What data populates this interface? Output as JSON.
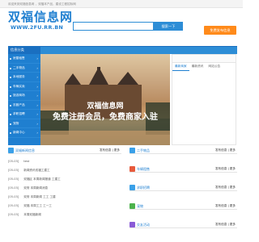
{
  "topbar": {
    "notice": "欢迎来到双福信息网 ，双福本产品，建设工程招标网"
  },
  "logo": {
    "title": "双福信息网",
    "url": "WWW.2FU.RR.BN"
  },
  "search": {
    "tabs": [
      "信息",
      "商家",
      "新闻",
      "找工作"
    ],
    "button_label": "搜索一下",
    "placeholder": ""
  },
  "post_button": "免费发布信息",
  "sidebar": {
    "heading": "信息分类",
    "items": [
      "房屋租售",
      "二手物品",
      "本地服务",
      "车辆买卖",
      "旅游商场",
      "农副产品",
      "求职招聘",
      "宠物",
      "新闻中心"
    ]
  },
  "nav": {
    "items": [
      "首页",
      "中考考试",
      "双福医院招聘",
      "双福学校教育",
      "双福二手房",
      "本地新闻",
      "商家信息"
    ]
  },
  "banner": {
    "line1": "双福信息网",
    "line2": "免费注册会员，免费商家入驻"
  },
  "right_panel": {
    "tabs": [
      "最新商家",
      "最新资讯",
      "网站公告"
    ]
  },
  "left_sections": [
    {
      "title": "双福新闻信息",
      "more": "发布信息 | 更多",
      "icon_color": "#3aa0e8",
      "rows": [
        {
          "date": "[05-03]",
          "text": "test"
        },
        {
          "date": "[05-03]",
          "text": "新闻资讯双福工建工"
        },
        {
          "date": "[05-03]",
          "text": "双福区 本周新闻报道 工建工"
        },
        {
          "date": "[05-03]",
          "text": "双府 本周新闻消息"
        },
        {
          "date": "[05-03]",
          "text": "双府 本周新闻 工工 工建"
        },
        {
          "date": "[05-03]",
          "text": "双福 本周工工 工一工"
        },
        {
          "date": "[05-03]",
          "text": "本周双福新闻"
        }
      ]
    }
  ],
  "right_sections": [
    {
      "title": "二手物品",
      "more": "发布信息 | 更多",
      "icon_color": "#3aa0e8"
    },
    {
      "title": "车辆租售",
      "more": "发布信息 | 更多",
      "icon_color": "#e75a3c"
    },
    {
      "title": "求职招聘",
      "more": "发布信息 | 更多",
      "icon_color": "#3aa0e8"
    },
    {
      "title": "宠物",
      "more": "发布信息 | 更多",
      "icon_color": "#4cb24c"
    },
    {
      "title": "交友活动",
      "more": "发布信息 | 更多",
      "icon_color": "#8a5bd6"
    }
  ],
  "colors": {
    "brand": "#1f7fd0",
    "accent": "#ff8a1a"
  }
}
